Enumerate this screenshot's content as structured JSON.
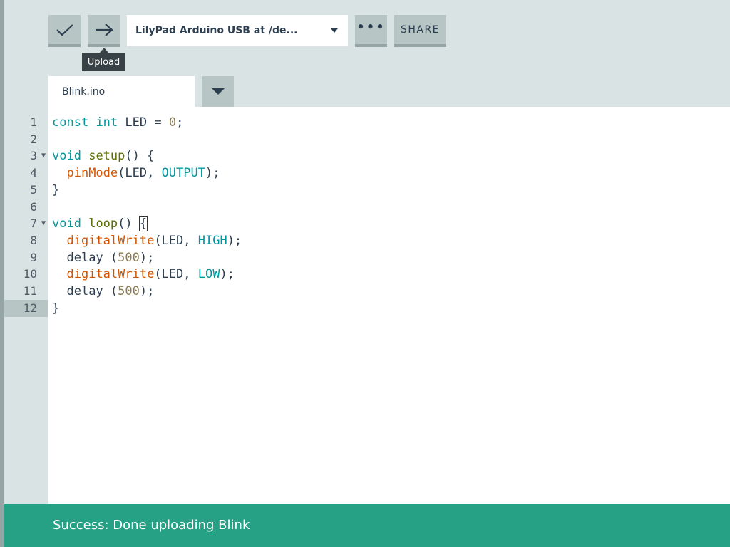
{
  "toolbar": {
    "verify_icon": "checkmark-icon",
    "upload_icon": "arrow-right-icon",
    "board_selected": "LilyPad Arduino USB at /de...",
    "more_label": "•••",
    "share_label": "SHARE"
  },
  "tooltip": {
    "text": "Upload"
  },
  "tabs": [
    {
      "label": "Blink.ino"
    }
  ],
  "editor": {
    "active_line": 12,
    "lines": [
      {
        "n": "1"
      },
      {
        "n": "2"
      },
      {
        "n": "3"
      },
      {
        "n": "4"
      },
      {
        "n": "5"
      },
      {
        "n": "6"
      },
      {
        "n": "7"
      },
      {
        "n": "8"
      },
      {
        "n": "9"
      },
      {
        "n": "10"
      },
      {
        "n": "11"
      },
      {
        "n": "12"
      }
    ],
    "code": {
      "l1": {
        "kw1": "const",
        "kw2": "int",
        "id": " LED = ",
        "num": "0",
        "end": ";"
      },
      "l3": {
        "kw": "void",
        "fn": "setup",
        "rest": "() {"
      },
      "l4": {
        "api": "pinMode",
        "args": "(LED, ",
        "const": "OUTPUT",
        "end": ");"
      },
      "l5": {
        "text": "}"
      },
      "l7": {
        "kw": "void",
        "fn": "loop",
        "rest": "() ",
        "brace": "{"
      },
      "l8": {
        "api": "digitalWrite",
        "args": "(LED, ",
        "const": "HIGH",
        "end": ");"
      },
      "l9": {
        "fn": "delay",
        "open": " (",
        "num": "500",
        "end": ");"
      },
      "l10": {
        "api": "digitalWrite",
        "args": "(LED, ",
        "const": "LOW",
        "end": ");"
      },
      "l11": {
        "fn": "delay",
        "open": " (",
        "num": "500",
        "end": ");"
      },
      "l12": {
        "text": "}"
      }
    }
  },
  "status": {
    "message": "Success: Done uploading Blink"
  },
  "colors": {
    "status_bg": "#26a186",
    "toolbar_btn": "#b8c5c5",
    "keyword": "#00979d",
    "api": "#d35400",
    "function": "#5e6d03"
  }
}
